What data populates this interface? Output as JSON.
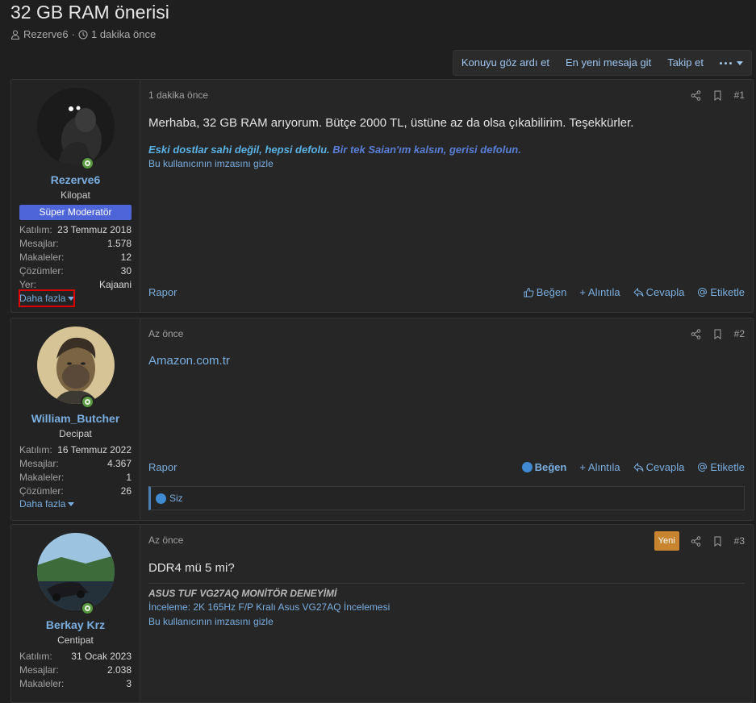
{
  "thread": {
    "title": "32 GB RAM önerisi",
    "author": "Rezerve6",
    "separator": "·",
    "time": "1 dakika önce"
  },
  "actions": {
    "ignore": "Konuyu göz ardı et",
    "newest": "En yeni mesaja git",
    "follow": "Takip et"
  },
  "posts": [
    {
      "username": "Rezerve6",
      "user_title": "Kilopat",
      "badge": "Süper Moderatör",
      "stats": [
        {
          "k": "Katılım:",
          "v": "23 Temmuz 2018"
        },
        {
          "k": "Mesajlar:",
          "v": "1.578"
        },
        {
          "k": "Makaleler:",
          "v": "12"
        },
        {
          "k": "Çözümler:",
          "v": "30"
        },
        {
          "k": "Yer:",
          "v": "Kajaani"
        }
      ],
      "more": "Daha fazla",
      "time": "1 dakika önce",
      "number": "#1",
      "body": "Merhaba, 32 GB RAM arıyorum. Bütçe 2000 TL, üstüne az da olsa çıkabilirim. Teşekkürler.",
      "signature_part1": "Eski dostlar sahi değil, hepsi defolu. ",
      "signature_part2": "Bir tek Saian'ım kalsın, gerisi defolun.",
      "sig_hide": "Bu kullanıcının imzasını gizle"
    },
    {
      "username": "William_Butcher",
      "user_title": "Decipat",
      "stats": [
        {
          "k": "Katılım:",
          "v": "16 Temmuz 2022"
        },
        {
          "k": "Mesajlar:",
          "v": "4.367"
        },
        {
          "k": "Makaleler:",
          "v": "1"
        },
        {
          "k": "Çözümler:",
          "v": "26"
        }
      ],
      "more": "Daha fazla",
      "time": "Az önce",
      "number": "#2",
      "body": "Amazon.com.tr",
      "likes": "Siz"
    },
    {
      "username": "Berkay Krz",
      "user_title": "Centipat",
      "stats": [
        {
          "k": "Katılım:",
          "v": "31 Ocak 2023"
        },
        {
          "k": "Mesajlar:",
          "v": "2.038"
        },
        {
          "k": "Makaleler:",
          "v": "3"
        }
      ],
      "time": "Az önce",
      "new_badge": "Yeni",
      "number": "#3",
      "body": "DDR4 mü 5 mi?",
      "sig_title": "ASUS TUF VG27AQ MONİTÖR DENEYİMİ",
      "sig_line": "İnceleme: 2K 165Hz F/P Kralı Asus VG27AQ İncelemesi",
      "sig_hide": "Bu kullanıcının imzasını gizle"
    }
  ],
  "footer": {
    "report": "Rapor",
    "like": "Beğen",
    "quote": "Alıntıla",
    "reply": "Cevapla",
    "tag": "Etiketle"
  },
  "colors": {
    "link": "#7aaee0",
    "badge": "#4d65d8",
    "new": "#c8842e",
    "highlight": "#e10000"
  }
}
